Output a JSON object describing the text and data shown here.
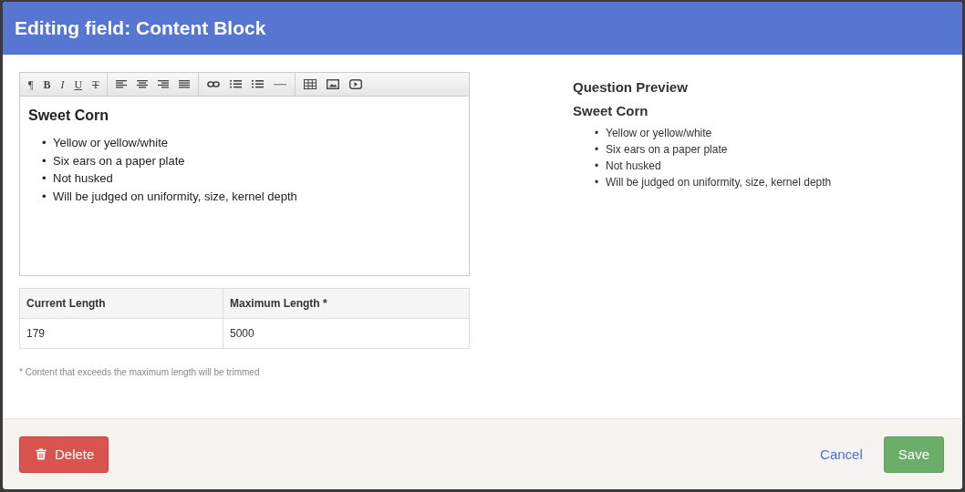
{
  "dialog": {
    "title": "Editing field: Content Block"
  },
  "toolbar": [
    [
      {
        "kind": "glyph",
        "label": "¶"
      },
      {
        "kind": "bold",
        "label": "B"
      },
      {
        "kind": "italic",
        "label": "I"
      },
      {
        "kind": "underline",
        "label": "U"
      },
      {
        "kind": "strike",
        "label": "T"
      }
    ],
    [
      {
        "kind": "align-left"
      },
      {
        "kind": "align-center"
      },
      {
        "kind": "align-right"
      },
      {
        "kind": "justify"
      }
    ],
    [
      {
        "kind": "link"
      },
      {
        "kind": "bullets"
      },
      {
        "kind": "numbers"
      },
      {
        "kind": "rule"
      }
    ],
    [
      {
        "kind": "table"
      },
      {
        "kind": "image"
      },
      {
        "kind": "video"
      }
    ]
  ],
  "editor": {
    "heading": "Sweet Corn",
    "bullet": "•",
    "items": [
      "Yellow or yellow/white",
      "Six ears on a paper plate",
      "Not husked",
      "Will be judged on uniformity, size, kernel depth"
    ]
  },
  "length_table": {
    "columns": [
      "Current Length",
      "Maximum Length *"
    ],
    "rows": [
      [
        "179",
        "5000"
      ]
    ]
  },
  "note": "* Content that exceeds the maximum length will be trimmed",
  "preview": {
    "title": "Question Preview",
    "heading": "Sweet Corn",
    "bullet": "•",
    "items": [
      "Yellow or yellow/white",
      "Six ears on a paper plate",
      "Not husked",
      "Will be judged on uniformity, size, kernel depth"
    ]
  },
  "footer": {
    "delete": "Delete",
    "cancel": "Cancel",
    "save": "Save"
  }
}
